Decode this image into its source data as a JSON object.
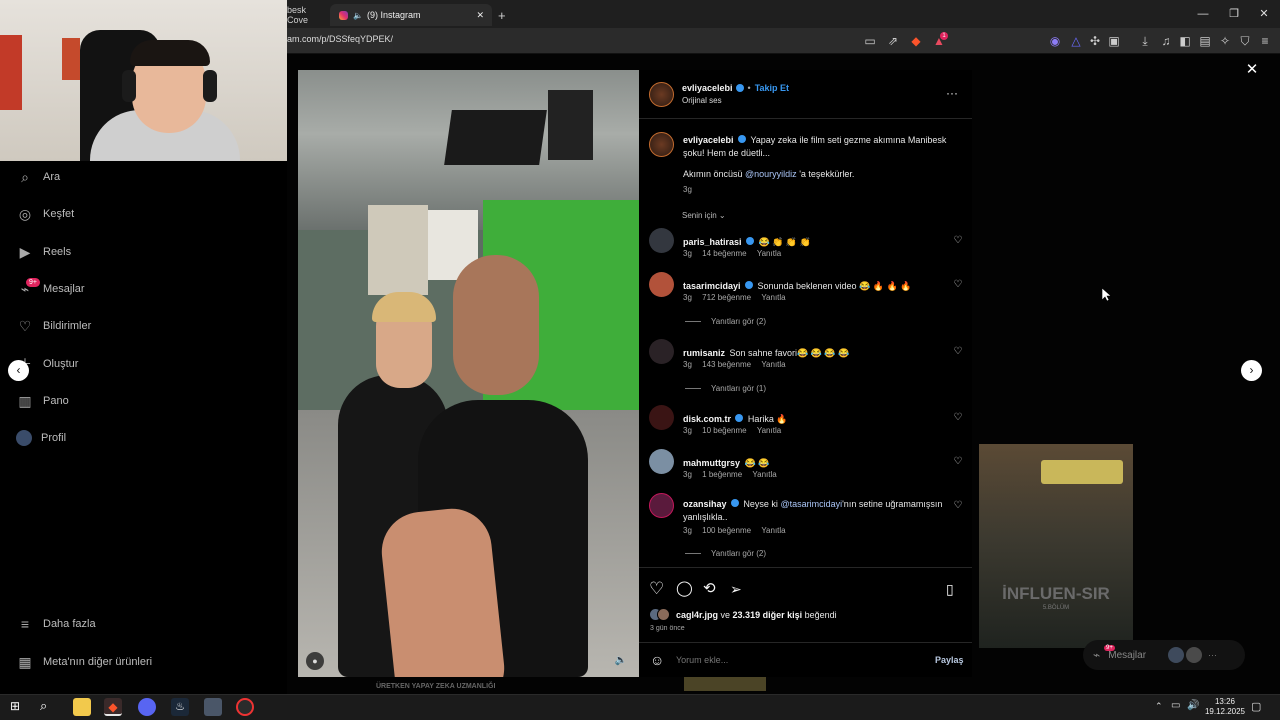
{
  "browser": {
    "tabs": [
      {
        "title": "besk Cove"
      },
      {
        "title": "(9) Instagram"
      }
    ],
    "new_tab": "+",
    "url": "am.com/p/DSSfeqYDPEK/",
    "notification_badge": "1",
    "window_controls": {
      "minimize": "—",
      "restore": "❐",
      "close": "✕"
    }
  },
  "sidebar": {
    "items": [
      {
        "label": "Ara",
        "icon": "search-icon"
      },
      {
        "label": "Keşfet",
        "icon": "compass-icon"
      },
      {
        "label": "Reels",
        "icon": "reels-icon"
      },
      {
        "label": "Mesajlar",
        "icon": "messenger-icon",
        "badge": "9+"
      },
      {
        "label": "Bildirimler",
        "icon": "heart-icon"
      },
      {
        "label": "Oluştur",
        "icon": "plus-icon"
      },
      {
        "label": "Pano",
        "icon": "dashboard-icon"
      },
      {
        "label": "Profil",
        "icon": "avatar-icon"
      }
    ],
    "more": "Daha fazla",
    "meta_products": "Meta'nın diğer ürünleri"
  },
  "post": {
    "author": "evliyacelebi",
    "follow": "Takip Et",
    "audio": "Orijinal ses",
    "caption": "Yapay zeka ile film seti gezme akımına Manibesk şoku! Hem de düetli...",
    "caption_line2_prefix": "Akımın öncüsü ",
    "caption_mention": "@nouryyildiz",
    "caption_line2_suffix": " 'a teşekkürler.",
    "caption_time": "3g",
    "sort_label": "Senin için",
    "likes_user": "cagl4r.jpg",
    "likes_rest_prefix": " ve ",
    "likes_count": "23.319 diğer kişi",
    "likes_suffix": " beğendi",
    "posted": "3 gün önce",
    "comment_placeholder": "Yorum ekle...",
    "share_label": "Paylaş"
  },
  "comments": [
    {
      "user": "paris_hatirasi",
      "verified": true,
      "text": "😂 👏 👏 👏",
      "time": "3g",
      "likes": "14 beğenme",
      "reply": "Yanıtla",
      "replies": ""
    },
    {
      "user": "tasarimcidayi",
      "verified": true,
      "text": "Sonunda beklenen video 😂 🔥 🔥 🔥",
      "time": "3g",
      "likes": "712 beğenme",
      "reply": "Yanıtla",
      "replies": "Yanıtları gör (2)"
    },
    {
      "user": "rumisaniz",
      "verified": false,
      "text": "Son sahne favori😂 😂 😂 😂",
      "time": "3g",
      "likes": "143 beğenme",
      "reply": "Yanıtla",
      "replies": "Yanıtları gör (1)"
    },
    {
      "user": "disk.com.tr",
      "verified": true,
      "text": "Harika 🔥",
      "time": "3g",
      "likes": "10 beğenme",
      "reply": "Yanıtla",
      "replies": ""
    },
    {
      "user": "mahmuttgrsy",
      "verified": false,
      "text": "😂 😂",
      "time": "3g",
      "likes": "1 beğenme",
      "reply": "Yanıtla",
      "replies": ""
    },
    {
      "user": "ozansihay",
      "verified": true,
      "text_prefix": "Neyse ki ",
      "mention": "@tasarimcidayi",
      "text_suffix": "'nın setine uğramamışsın",
      "text_line2": "yanlışlıkla..",
      "time": "3g",
      "likes": "100 beğenme",
      "reply": "Yanıtla",
      "replies": "Yanıtları gör (2)"
    }
  ],
  "background": {
    "thumb_title": "İNFLUEN-SIR",
    "thumb_sub": "5.BÖLÜM",
    "bottom_caption": "ÜRETKEN YAPAY ZEKA UZMANLIĞI",
    "messages_chip": "Mesajlar",
    "messages_badge": "9+"
  },
  "taskbar": {
    "time": "13:26",
    "date": "19.12.2025"
  },
  "colors": {
    "accent": "#3897f0",
    "instagram_bg": "#000000",
    "green_screen": "#3fae3a"
  }
}
